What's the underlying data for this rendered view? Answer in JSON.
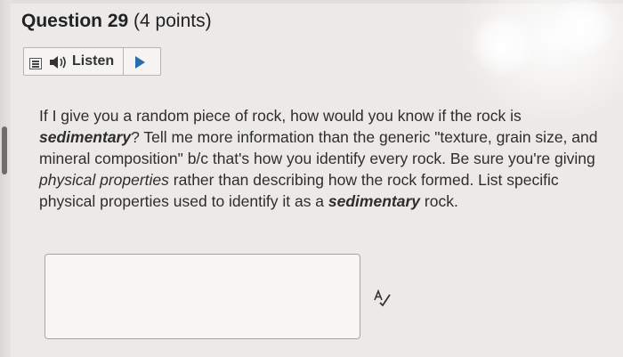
{
  "question": {
    "title": "Question 29",
    "points": "(4 points)"
  },
  "listen_bar": {
    "label": "Listen",
    "icons": [
      "menu-icon",
      "speaker-icon",
      "play-icon"
    ]
  },
  "prompt": {
    "part1": "If I give you a random piece of rock, how would you know if the rock is ",
    "part2": "sedimentary",
    "part3": "? Tell me more information than the generic \"texture, grain size, and mineral composition\" b/c that's how you identify every rock. Be sure you're giving ",
    "part4": "physical properties",
    "part5": " rather than describing how the rock formed. List specific physical properties used to identify it as a ",
    "part6": "sedimentary",
    "part7": " rock."
  },
  "answer": {
    "value": "",
    "spellcheck_icon": "spellcheck-icon"
  },
  "colors": {
    "play": "#2b6cb0",
    "background": "#eceae8"
  }
}
